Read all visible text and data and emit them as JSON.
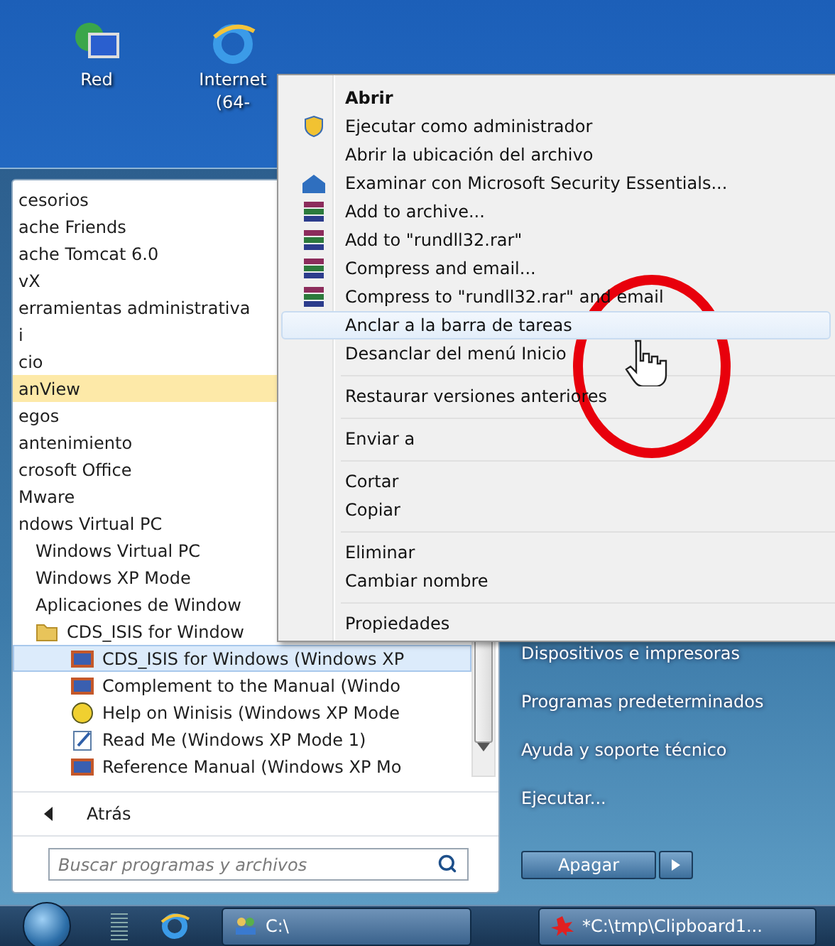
{
  "desktop_icons": [
    {
      "kind": "network",
      "lines": [
        "Red"
      ]
    },
    {
      "kind": "browser",
      "lines": [
        "Internet",
        "(64-"
      ]
    }
  ],
  "start_menu": {
    "programs": [
      {
        "label": "cesorios",
        "selected": false,
        "new": false
      },
      {
        "label": "ache Friends",
        "selected": false,
        "new": false
      },
      {
        "label": "ache Tomcat 6.0",
        "selected": false,
        "new": false
      },
      {
        "label": "vX",
        "selected": false,
        "new": false
      },
      {
        "label": "erramientas administrativa",
        "selected": false,
        "new": false
      },
      {
        "label": "i",
        "selected": false,
        "new": false
      },
      {
        "label": "cio",
        "selected": false,
        "new": false
      },
      {
        "label": "anView",
        "selected": false,
        "new": true
      },
      {
        "label": "egos",
        "selected": false,
        "new": false
      },
      {
        "label": "antenimiento",
        "selected": false,
        "new": false
      },
      {
        "label": "crosoft Office",
        "selected": false,
        "new": false
      },
      {
        "label": "Mware",
        "selected": false,
        "new": false
      },
      {
        "label": "ndows Virtual PC",
        "selected": false,
        "new": false,
        "children": [
          {
            "label": "Windows Virtual PC",
            "selected": false,
            "new": false
          },
          {
            "label": "Windows XP Mode",
            "selected": false,
            "new": false
          },
          {
            "label": "Aplicaciones de Window",
            "selected": false,
            "new": false
          },
          {
            "kind": "folder",
            "label": "CDS_ISIS for Window",
            "selected": false,
            "new": false,
            "children": [
              {
                "kind": "program",
                "label": "CDS_ISIS for Windows (Windows XP",
                "selected": true,
                "new": false
              },
              {
                "kind": "program",
                "label": "Complement to the Manual (Windo",
                "selected": false,
                "new": false
              },
              {
                "kind": "help",
                "label": "Help on Winisis (Windows XP Mode",
                "selected": false,
                "new": false
              },
              {
                "kind": "document",
                "label": "Read Me (Windows XP Mode 1)",
                "selected": false,
                "new": false
              },
              {
                "kind": "program",
                "label": "Reference Manual (Windows XP Mo",
                "selected": false,
                "new": false
              }
            ]
          }
        ]
      }
    ],
    "back": "Atrás",
    "search": {
      "placeholder": "Buscar programas y archivos"
    },
    "links": [
      "Dispositivos e impresoras",
      "Programas predeterminados",
      "Ayuda y soporte técnico",
      "Ejecutar..."
    ],
    "shutdown": "Apagar"
  },
  "context_menu": {
    "groups": [
      [
        {
          "kind": "default",
          "label": "Abrir",
          "selected": false
        },
        {
          "kind": "admin",
          "label": "Ejecutar como administrador",
          "selected": false
        },
        {
          "kind": "plain",
          "label": "Abrir la ubicación del archivo",
          "selected": false
        },
        {
          "kind": "scan",
          "label": "Examinar con Microsoft Security Essentials...",
          "selected": false
        },
        {
          "kind": "archive",
          "label": "Add to archive...",
          "selected": false
        },
        {
          "kind": "archive",
          "label": "Add to \"rundll32.rar\"",
          "selected": false
        },
        {
          "kind": "archive",
          "label": "Compress and email...",
          "selected": false
        },
        {
          "kind": "archive",
          "label": "Compress to \"rundll32.rar\" and email",
          "selected": false
        },
        {
          "kind": "plain",
          "label": "Anclar a la barra de tareas",
          "selected": true
        },
        {
          "kind": "plain",
          "label": "Desanclar del menú Inicio",
          "selected": false
        }
      ],
      [
        {
          "kind": "plain",
          "label": "Restaurar versiones anteriores",
          "selected": false
        }
      ],
      [
        {
          "kind": "plain",
          "label": "Enviar a",
          "selected": false
        }
      ],
      [
        {
          "kind": "plain",
          "label": "Cortar",
          "selected": false
        },
        {
          "kind": "plain",
          "label": "Copiar",
          "selected": false
        }
      ],
      [
        {
          "kind": "plain",
          "label": "Eliminar",
          "selected": false
        },
        {
          "kind": "plain",
          "label": "Cambiar nombre",
          "selected": false
        }
      ],
      [
        {
          "kind": "plain",
          "label": "Propiedades",
          "selected": false
        }
      ]
    ]
  },
  "taskbar": {
    "buttons": [
      {
        "kind": "console",
        "label": "C:\\"
      },
      {
        "kind": "paint",
        "label": "*C:\\tmp\\Clipboard1..."
      }
    ]
  }
}
